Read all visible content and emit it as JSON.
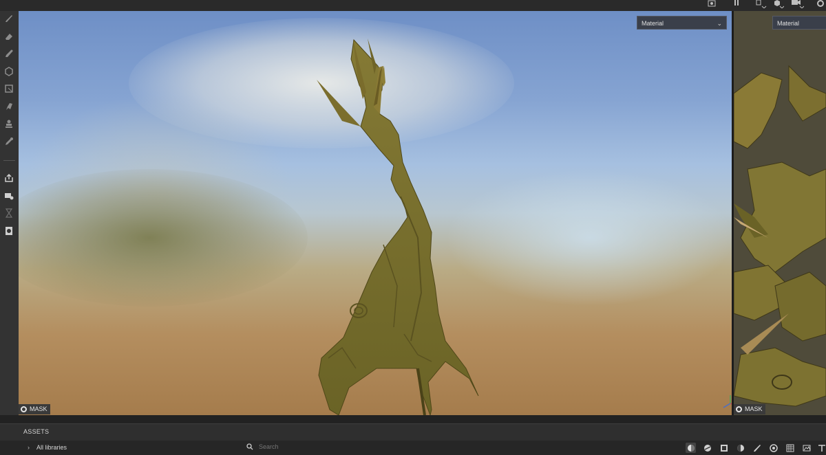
{
  "viewport3d": {
    "channel_select": "Material",
    "mask_label": "MASK"
  },
  "viewport2d": {
    "channel_select": "Material",
    "mask_label": "MASK"
  },
  "assets": {
    "title": "ASSETS",
    "library_label": "All libraries",
    "search_placeholder": "Search"
  },
  "tools": [
    "paint-brush-icon",
    "eraser-icon",
    "projection-icon",
    "polygon-fill-icon",
    "smudge-icon",
    "clone-stamp-icon",
    "bake-icon",
    "color-picker-icon",
    "export-icon",
    "bake-textures-icon",
    "history-icon",
    "texture-set-icon"
  ],
  "colors": {
    "panel": "#2b2b2b",
    "toolbar": "#333333",
    "accent_dropdown": "#3a3f4a"
  }
}
